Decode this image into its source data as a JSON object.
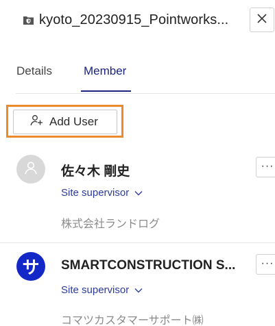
{
  "header": {
    "title": "kyoto_20230915_Pointworks...",
    "folder_icon": "folder-shield-icon",
    "close_label": "X"
  },
  "tabs": [
    {
      "label": "Details",
      "active": false
    },
    {
      "label": "Member",
      "active": true
    }
  ],
  "add_user": {
    "label": "Add User",
    "icon": "add-user-icon",
    "highlight_color": "#ee8a2e"
  },
  "members": [
    {
      "name": "佐々木 剛史",
      "role": "Site supervisor",
      "company": "株式会社ランドログ",
      "avatar_letter": "",
      "avatar_color": "#d8d8d8",
      "more_label": "···"
    },
    {
      "name": "SMARTCONSTRUCTION S...",
      "role": "Site supervisor",
      "company": "コマツカスタマーサポート㈱",
      "avatar_letter": "サ",
      "avatar_color": "#1428c8",
      "more_label": "···"
    }
  ],
  "colors": {
    "accent": "#1a237e",
    "role_link": "#2a3a9e",
    "muted_text": "#8a8a8a"
  }
}
